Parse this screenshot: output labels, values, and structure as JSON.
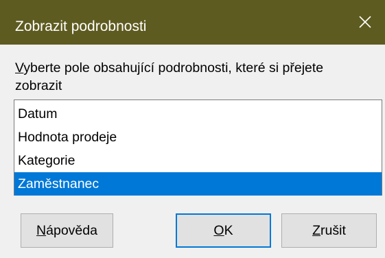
{
  "window": {
    "title": "Zobrazit podrobnosti",
    "titlebar_color": "#5e5b20",
    "close_icon": "close-icon"
  },
  "prompt": {
    "accel": "V",
    "text_rest": "yberte pole obsahující podrobnosti, které si přejete zobrazit"
  },
  "list": {
    "items": [
      {
        "label": "Datum",
        "selected": false
      },
      {
        "label": "Hodnota prodeje",
        "selected": false
      },
      {
        "label": "Kategorie",
        "selected": false
      },
      {
        "label": "Zaměstnanec",
        "selected": true
      }
    ],
    "selection_color": "#0078d7"
  },
  "buttons": {
    "help": {
      "accel": "N",
      "rest": "ápověda"
    },
    "ok": {
      "accel": "O",
      "rest": "K"
    },
    "cancel": {
      "accel": "Z",
      "rest": "rušit"
    }
  }
}
